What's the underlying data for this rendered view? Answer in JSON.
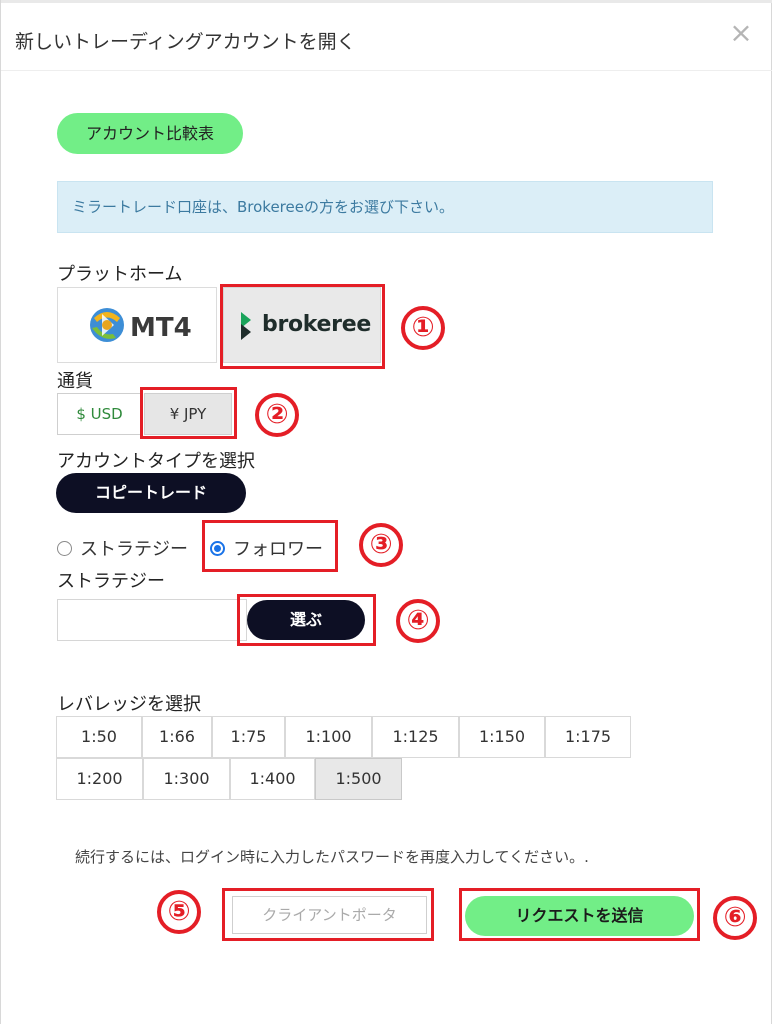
{
  "dialog": {
    "title": "新しいトレーディングアカウントを開く",
    "close_glyph": "×"
  },
  "compare_button": "アカウント比較表",
  "notice": "ミラートレード口座は、Brokereeの方をお選び下さい。",
  "platform": {
    "label": "プラットホーム",
    "options": [
      {
        "name": "MT4",
        "logo": "mt4-logo"
      },
      {
        "name": "brokeree",
        "logo": "brokeree-logo",
        "selected": true
      }
    ]
  },
  "currency": {
    "label": "通貨",
    "options": [
      {
        "label": "$ USD"
      },
      {
        "label": "¥ JPY",
        "selected": true
      }
    ]
  },
  "account_type": {
    "label": "アカウントタイプを選択",
    "button": "コピートレード",
    "radios": [
      {
        "label": "ストラテジー",
        "checked": false
      },
      {
        "label": "フォロワー",
        "checked": true
      }
    ]
  },
  "strategy": {
    "label": "ストラテジー",
    "value": "",
    "choose_button": "選ぶ"
  },
  "leverage": {
    "label": "レバレッジを選択",
    "options": [
      "1:50",
      "1:66",
      "1:75",
      "1:100",
      "1:125",
      "1:150",
      "1:175",
      "1:200",
      "1:300",
      "1:400",
      "1:500"
    ],
    "selected": "1:500"
  },
  "password_note": "続行するには、ログイン時に入力したパスワードを再度入力してください。.",
  "client_portal_button": "クライアントポータ",
  "request_button": "リクエストを送信",
  "annotations": [
    "①",
    "②",
    "③",
    "④",
    "⑤",
    "⑥"
  ],
  "colors": {
    "accent_green": "#72ee87",
    "dark_button": "#0d0f24",
    "annotation_red": "#e41e26",
    "radio_blue": "#1a73e8"
  }
}
